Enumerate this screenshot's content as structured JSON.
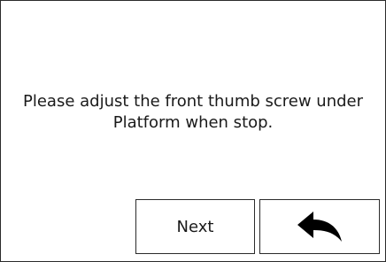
{
  "dialog": {
    "message_line1": "Please adjust the front thumb screw under",
    "message_line2": "Platform when stop."
  },
  "buttons": {
    "next_label": "Next",
    "back_icon": "back-arrow-icon"
  },
  "colors": {
    "border": "#2b2b2b",
    "text": "#1a1a1a",
    "background": "#ffffff"
  }
}
